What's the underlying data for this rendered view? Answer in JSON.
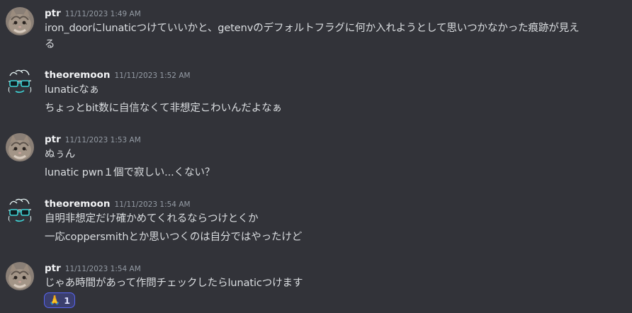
{
  "messages": [
    {
      "author": "ptr",
      "avatar": "cat-avatar",
      "timestamp": "11/11/2023 1:49 AM",
      "lines": [
        "iron_doorにlunaticつけていいかと、getenvのデフォルトフラグに何か入れようとして思いつかなかった痕跡が見え",
        "る"
      ]
    },
    {
      "author": "theoremoon",
      "avatar": "sketch-face-avatar",
      "timestamp": "11/11/2023 1:52 AM",
      "lines": [
        "lunaticなぁ",
        "ちょっとbit数に自信なくて非想定こわいんだよなぁ"
      ]
    },
    {
      "author": "ptr",
      "avatar": "cat-avatar",
      "timestamp": "11/11/2023 1:53 AM",
      "lines": [
        "ぬぅん",
        "lunatic pwn１個で寂しい...くない？"
      ]
    },
    {
      "author": "theoremoon",
      "avatar": "sketch-face-avatar",
      "timestamp": "11/11/2023 1:54 AM",
      "lines": [
        "自明非想定だけ確かめてくれるならつけとくか",
        "一応coppersmithとか思いつくのは自分ではやったけど"
      ]
    },
    {
      "author": "ptr",
      "avatar": "cat-avatar",
      "timestamp": "11/11/2023 1:54 AM",
      "lines": [
        "じゃあ時間があって作問チェックしたらlunaticつけます"
      ],
      "reaction": {
        "emoji": "🙏",
        "icon": "folded-hands-icon",
        "count": "1"
      }
    }
  ],
  "colors": {
    "background": "#323339",
    "author": "#f2f3f5",
    "text": "#dbdee1",
    "timestamp": "#949ba4",
    "reaction_bg": "#3b3f6e",
    "reaction_border": "#5865f2"
  }
}
